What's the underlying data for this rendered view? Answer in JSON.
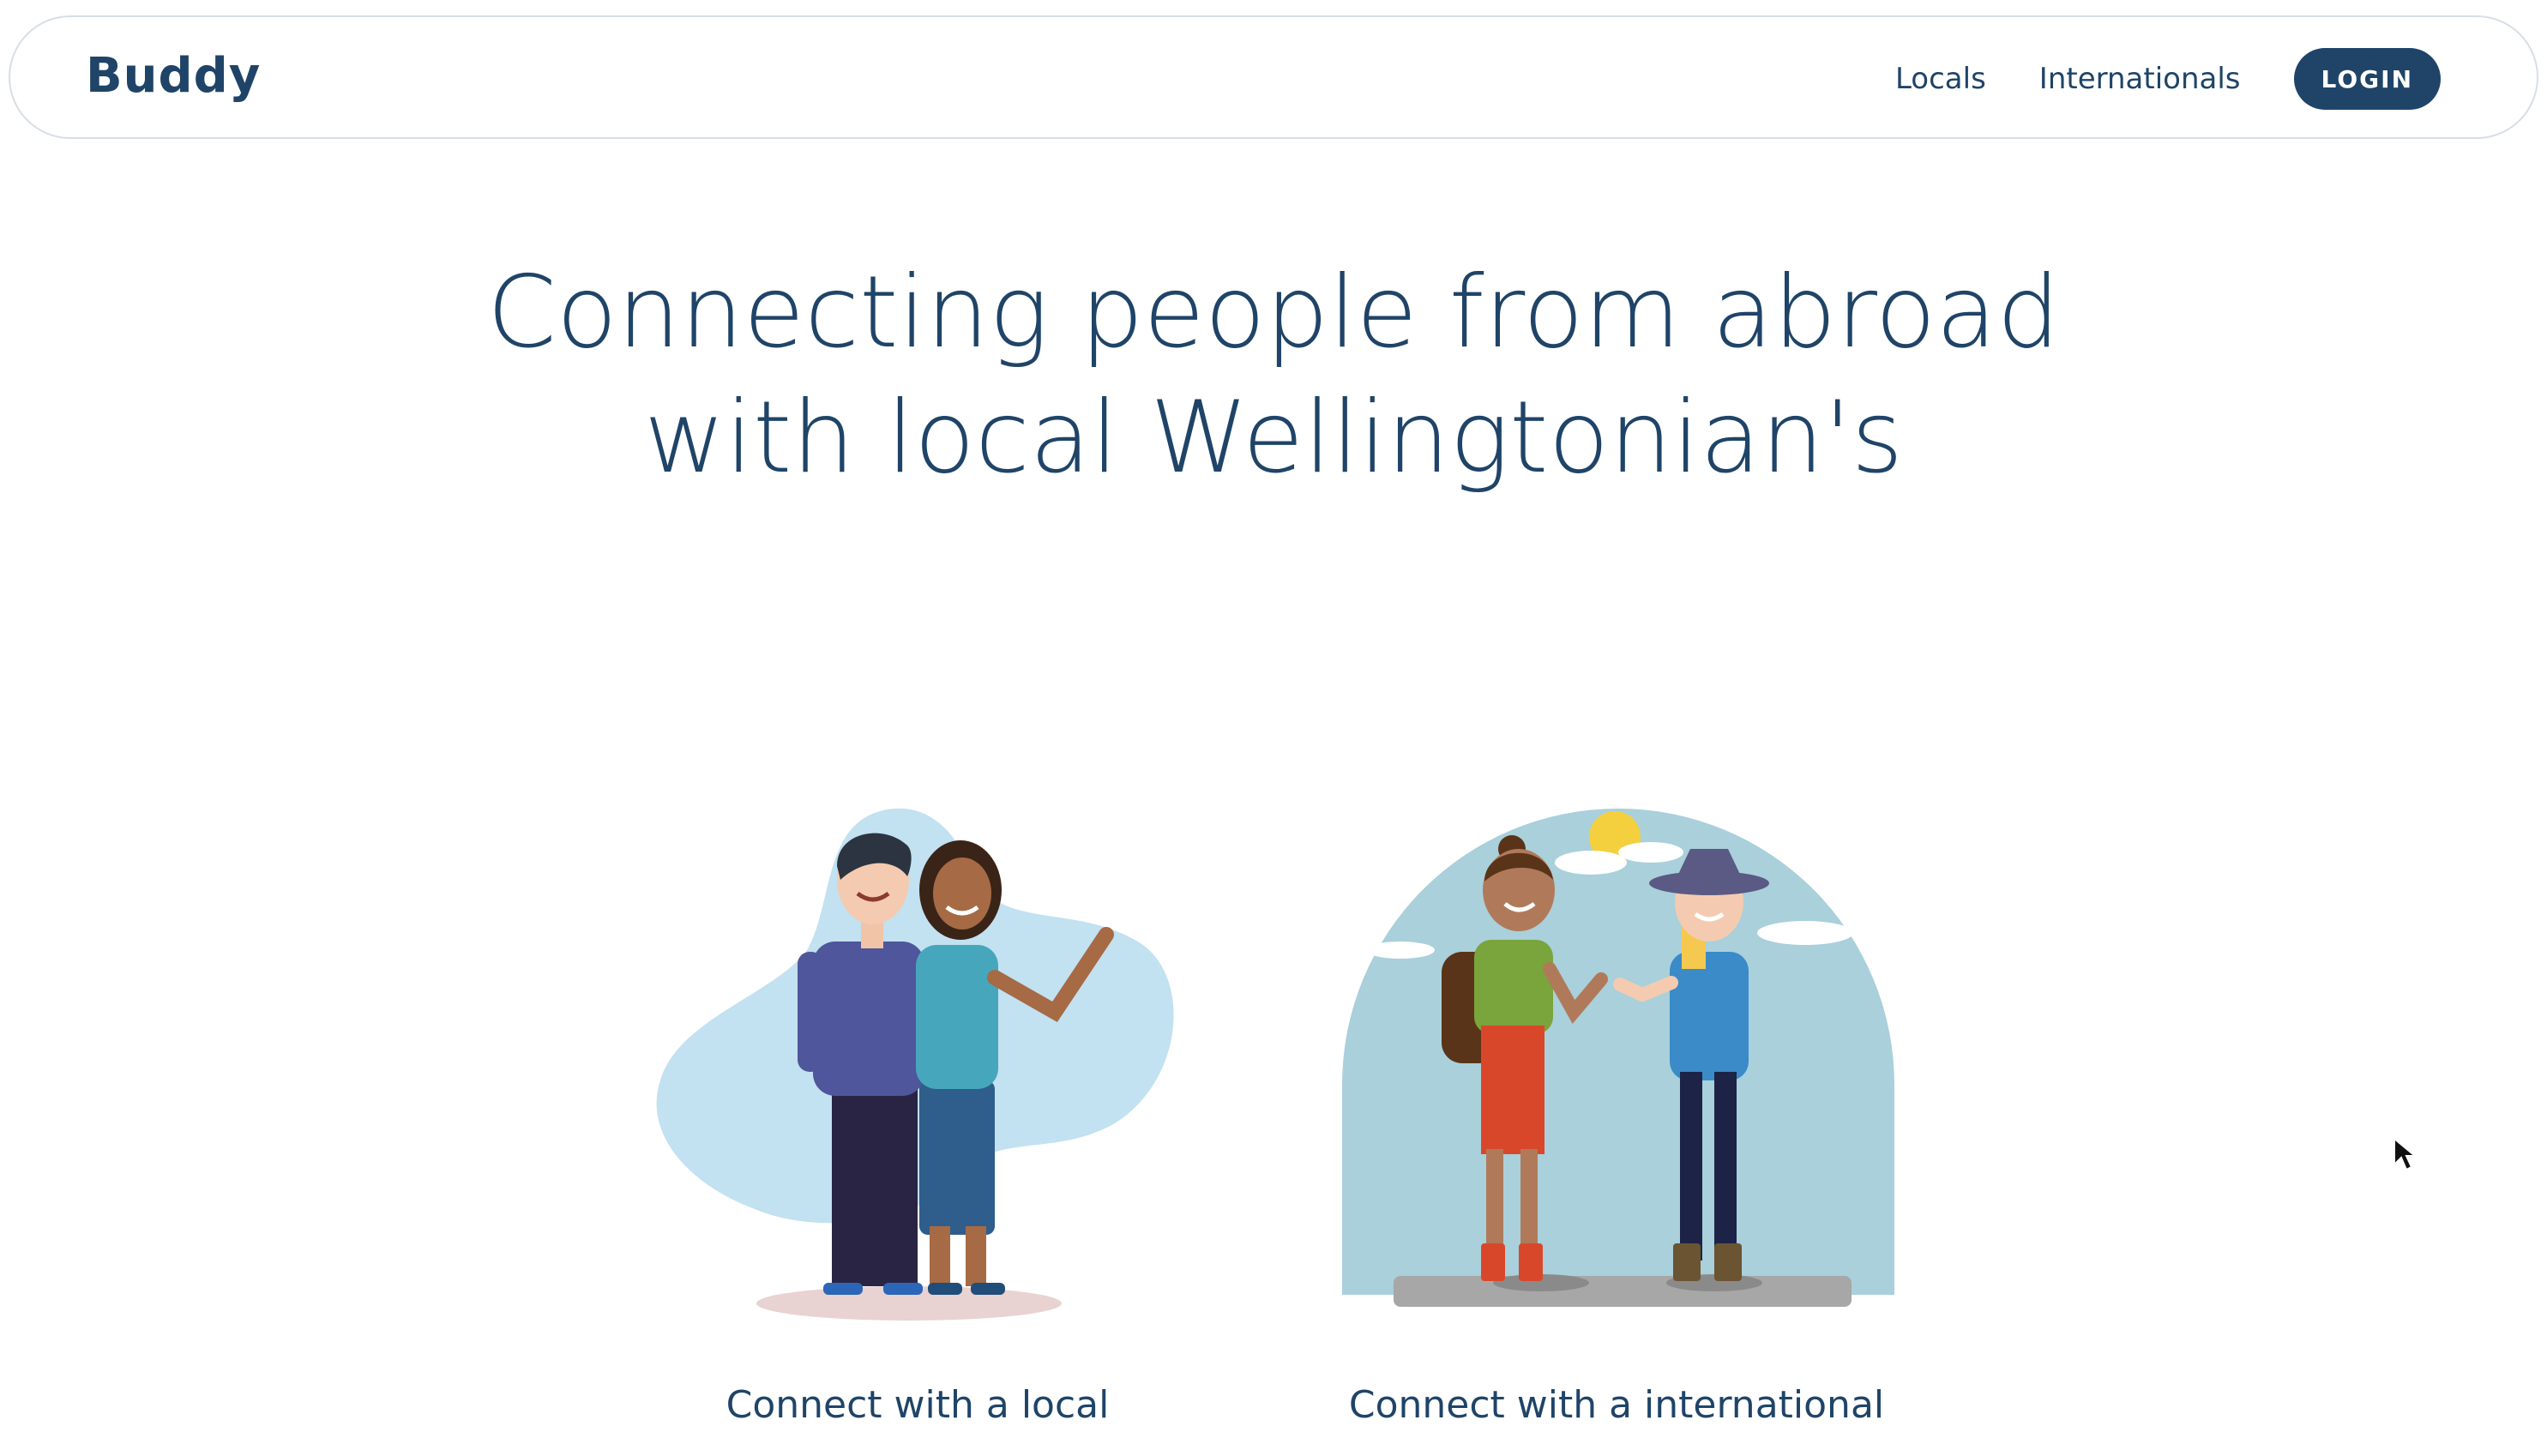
{
  "navbar": {
    "brand": "Buddy",
    "links": [
      "Locals",
      "Internationals"
    ],
    "login_label": "LOGIN"
  },
  "hero": {
    "line1": "Connecting people from abroad",
    "line2": "with local Wellingtonian's"
  },
  "cards": [
    {
      "caption": "Connect with a local",
      "illustration": "couple-illustration"
    },
    {
      "caption": "Connect with a international",
      "illustration": "travelers-illustration"
    }
  ],
  "colors": {
    "primary": "#1f4468",
    "blob_light_blue": "#c2e1f1",
    "circle_teal": "#a9d0db",
    "shadow_pink": "#e8d2d2"
  }
}
